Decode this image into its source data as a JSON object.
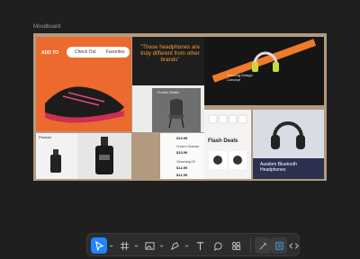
{
  "frame": {
    "label": "Moodboard"
  },
  "tiles": {
    "shoe": {
      "brand": "ADD TO",
      "cta_primary": "Check Out",
      "cta_secondary": "Favorites"
    },
    "quote": {
      "text": "\"These headphones are truly different from other brands\""
    },
    "dark": {
      "title": "Tracking Design Concept"
    },
    "chair": {
      "label": "Product Details"
    },
    "flash": {
      "title": "Flash Deals"
    },
    "headphones": {
      "title": "Ausdom Bluetooth Headphones"
    },
    "products": {
      "title": "Product",
      "items": [
        {
          "name": "Cream Cleanser",
          "price": "$15.99"
        },
        {
          "name": "Cleansing Oil",
          "price": "$12.99"
        },
        {
          "name": "",
          "price": "$12.99"
        }
      ],
      "top_price": "$19.99"
    }
  },
  "toolbar": {
    "tools": [
      "move-tool",
      "frame-tool",
      "image-tool",
      "pen-tool",
      "text-tool",
      "comment-tool",
      "components-tool",
      "dev-mode",
      "inspect",
      "code"
    ]
  },
  "colors": {
    "accent": "#1e86ff",
    "orange": "#ec6a2e",
    "board": "#b29a7f"
  }
}
